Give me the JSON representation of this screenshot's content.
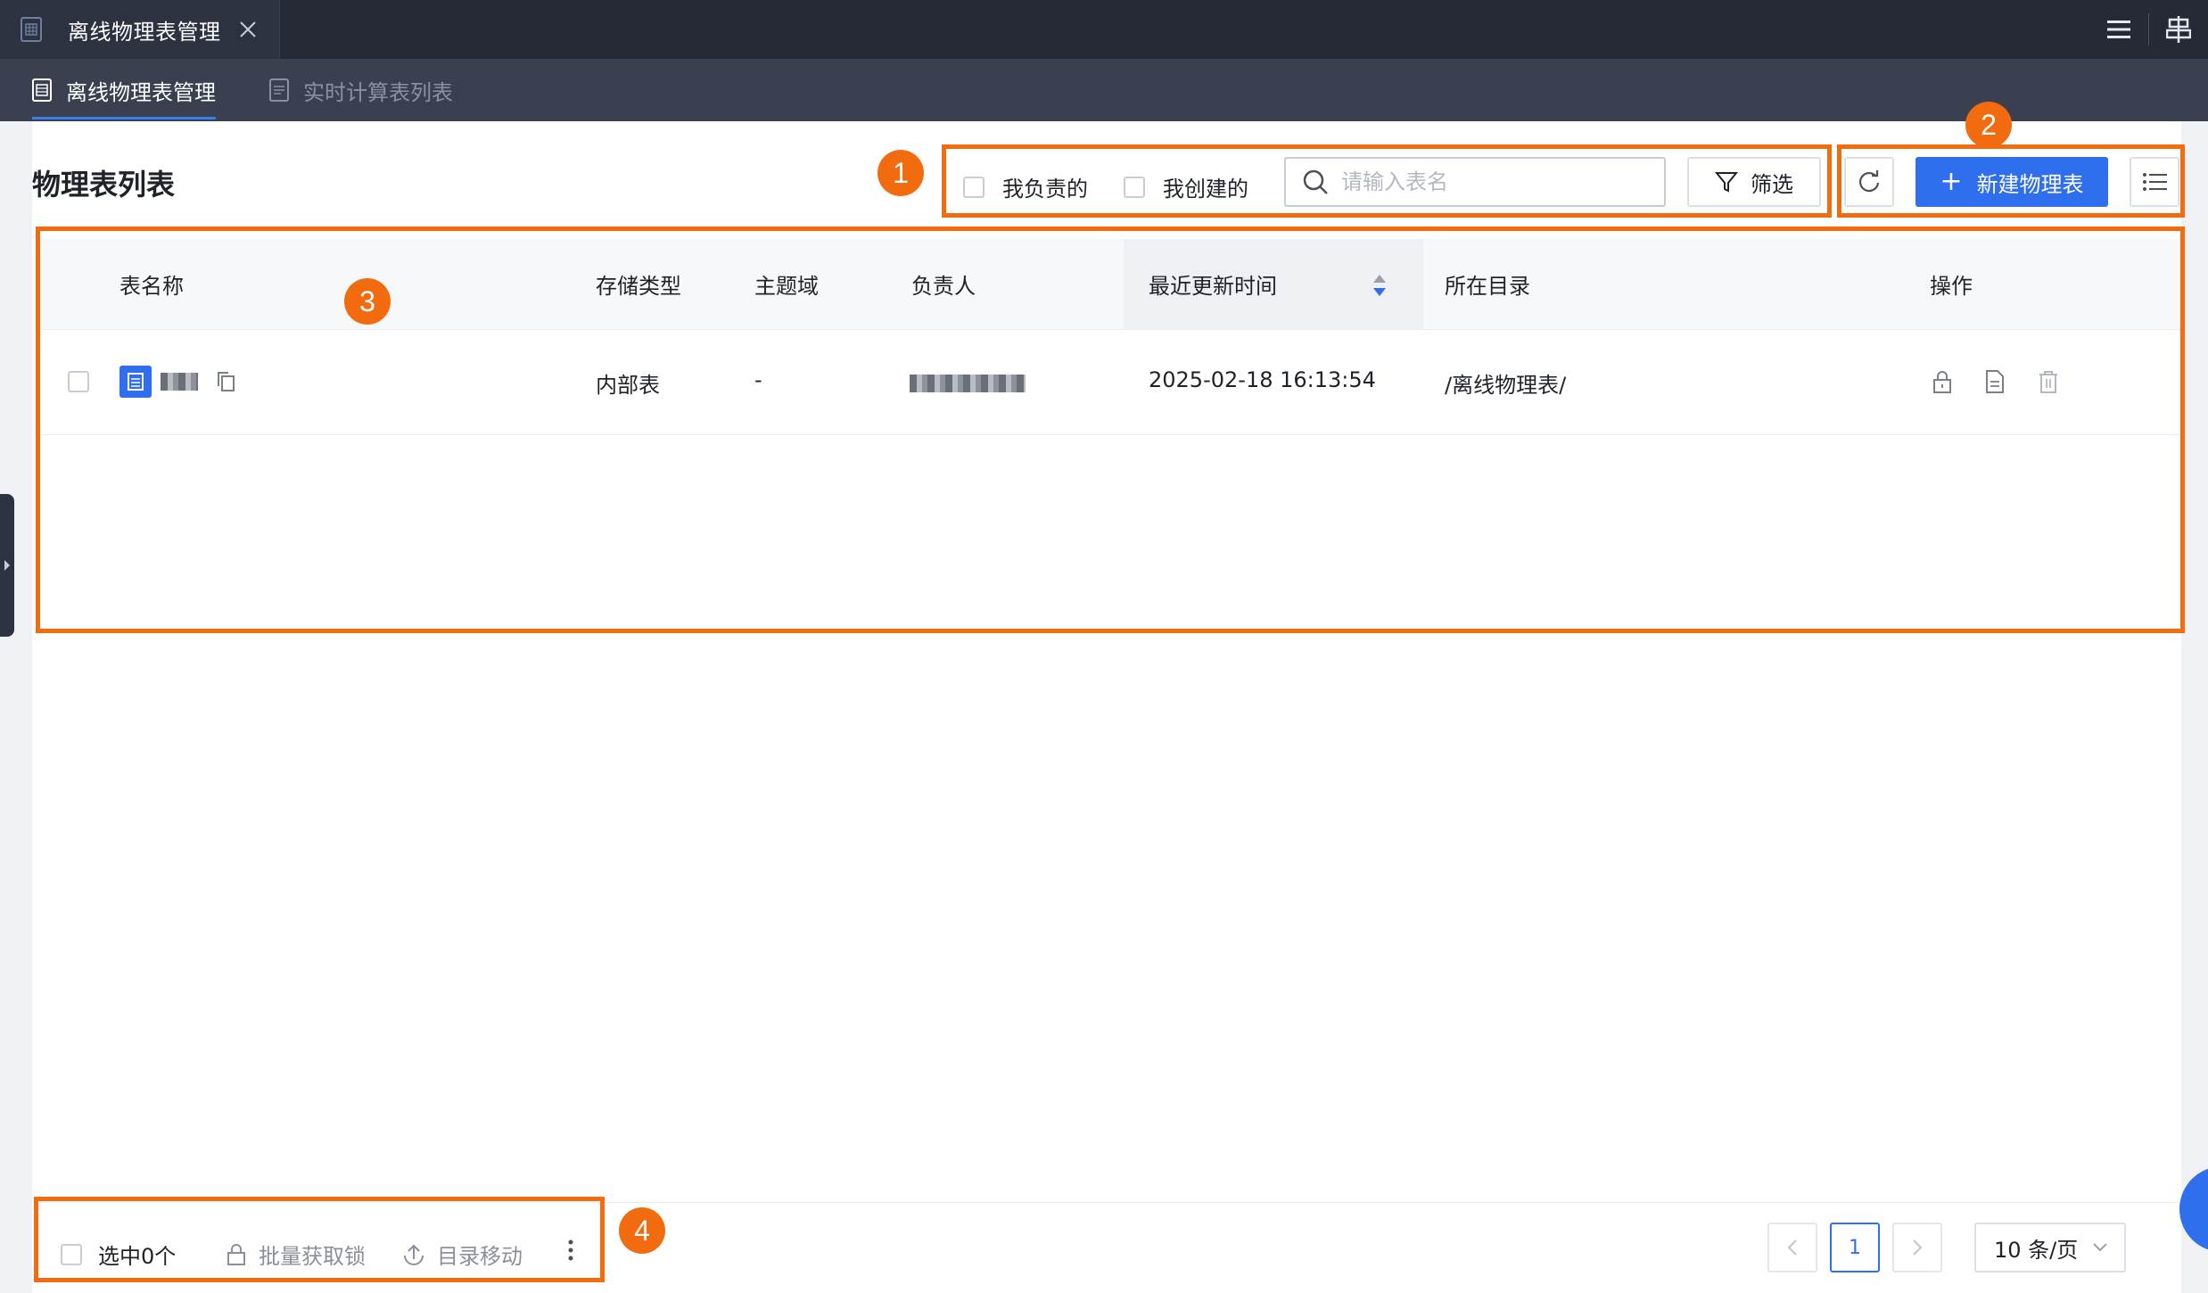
{
  "topbar": {
    "tab_title": "离线物理表管理"
  },
  "subnav": {
    "tabs": [
      {
        "label": "离线物理表管理",
        "active": true
      },
      {
        "label": "实时计算表列表",
        "active": false
      }
    ]
  },
  "page": {
    "title": "物理表列表"
  },
  "toolbar": {
    "my_responsible": "我负责的",
    "my_created": "我创建的",
    "search_placeholder": "请输入表名",
    "filter_label": "筛选",
    "new_table_label": "新建物理表"
  },
  "table": {
    "columns": {
      "name": "表名称",
      "storage_type": "存储类型",
      "domain": "主题域",
      "owner": "负责人",
      "updated": "最近更新时间",
      "directory": "所在目录",
      "actions": "操作"
    },
    "rows": [
      {
        "storage_type": "内部表",
        "domain": "-",
        "updated": "2025-02-18 16:13:54",
        "directory": "/离线物理表/"
      }
    ]
  },
  "footer": {
    "selected_label": "选中0个",
    "batch_lock": "批量获取锁",
    "move_dir": "目录移动",
    "current_page": "1",
    "page_size": "10 条/页"
  },
  "annotations": [
    "1",
    "2",
    "3",
    "4"
  ],
  "colors": {
    "primary": "#2f6fed",
    "annotation": "#f26b0f",
    "topbar": "#252a36",
    "subnav": "#3b4050"
  }
}
